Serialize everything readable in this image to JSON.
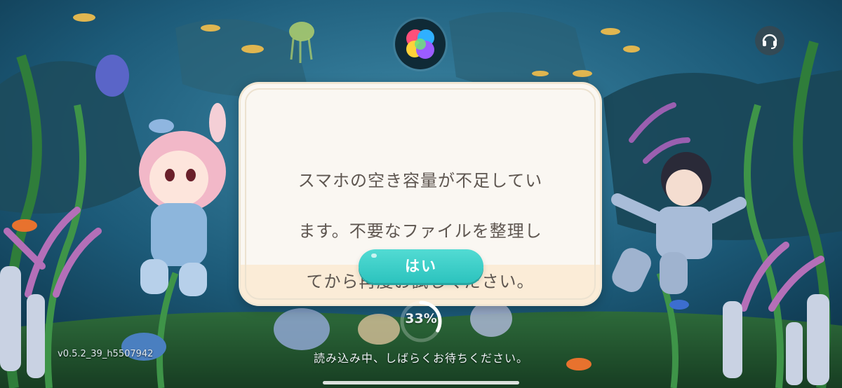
{
  "dialog": {
    "message": "スマホの空き容量が不足しています。不要なファイルを整理してから再度お試しください。",
    "message_lines": [
      "スマホの空き容量が不足してい",
      "ます。不要なファイルを整理し",
      "てから再度お試しください。"
    ],
    "confirm_label": "はい"
  },
  "loading": {
    "progress": 0.33,
    "progress_label": "33%",
    "status_text": "読み込み中、しばらくお待ちください。"
  },
  "version": "v0.5.2_39_h5507942",
  "icons": {
    "logo": "app-logo-icon",
    "help": "headset-help-icon"
  },
  "colors": {
    "dialog_bg": "#faf7f2",
    "dialog_footer": "#fbecd7",
    "button": "#3ecfc9",
    "text": "#5e5650"
  }
}
